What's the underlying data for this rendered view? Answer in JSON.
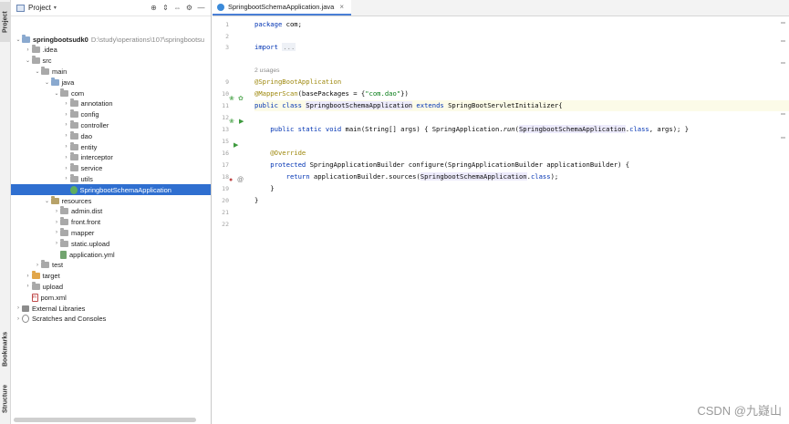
{
  "sidebar_strip": {
    "project_tab": "Project",
    "bookmarks_tab": "Bookmarks",
    "structure_tab": "Structure"
  },
  "project_panel": {
    "title": "Project",
    "tree": [
      {
        "label": "springbootsudk0",
        "hint": "D:\\study\\operations\\107\\springbootsu",
        "depth": 0,
        "arrow": "down",
        "icon": "folder-blue-icon",
        "bold": true
      },
      {
        "label": ".idea",
        "depth": 1,
        "arrow": "right",
        "icon": "folder-gray-icon"
      },
      {
        "label": "src",
        "depth": 1,
        "arrow": "down",
        "icon": "folder-gray-icon"
      },
      {
        "label": "main",
        "depth": 2,
        "arrow": "down",
        "icon": "folder-gray-icon"
      },
      {
        "label": "java",
        "depth": 3,
        "arrow": "down",
        "icon": "folder-blue-icon"
      },
      {
        "label": "com",
        "depth": 4,
        "arrow": "down",
        "icon": "package-icon"
      },
      {
        "label": "annotation",
        "depth": 5,
        "arrow": "right",
        "icon": "package-icon"
      },
      {
        "label": "config",
        "depth": 5,
        "arrow": "right",
        "icon": "package-icon"
      },
      {
        "label": "controller",
        "depth": 5,
        "arrow": "right",
        "icon": "package-icon"
      },
      {
        "label": "dao",
        "depth": 5,
        "arrow": "right",
        "icon": "package-icon"
      },
      {
        "label": "entity",
        "depth": 5,
        "arrow": "right",
        "icon": "package-icon"
      },
      {
        "label": "interceptor",
        "depth": 5,
        "arrow": "right",
        "icon": "package-icon"
      },
      {
        "label": "service",
        "depth": 5,
        "arrow": "right",
        "icon": "package-icon"
      },
      {
        "label": "utils",
        "depth": 5,
        "arrow": "right",
        "icon": "package-icon"
      },
      {
        "label": "SpringbootSchemaApplication",
        "depth": 5,
        "arrow": "",
        "icon": "spring-class-icon",
        "selected": true
      },
      {
        "label": "resources",
        "depth": 3,
        "arrow": "down",
        "icon": "resources-folder-icon"
      },
      {
        "label": "admin.dist",
        "depth": 4,
        "arrow": "right",
        "icon": "folder-gray-icon"
      },
      {
        "label": "front.front",
        "depth": 4,
        "arrow": "right",
        "icon": "folder-gray-icon"
      },
      {
        "label": "mapper",
        "depth": 4,
        "arrow": "right",
        "icon": "folder-gray-icon"
      },
      {
        "label": "static.upload",
        "depth": 4,
        "arrow": "right",
        "icon": "folder-gray-icon"
      },
      {
        "label": "application.yml",
        "depth": 4,
        "arrow": "",
        "icon": "yml-file-icon"
      },
      {
        "label": "test",
        "depth": 2,
        "arrow": "right",
        "icon": "folder-gray-icon"
      },
      {
        "label": "target",
        "depth": 1,
        "arrow": "right",
        "icon": "folder-orange-icon"
      },
      {
        "label": "upload",
        "depth": 1,
        "arrow": "right",
        "icon": "folder-gray-icon"
      },
      {
        "label": "pom.xml",
        "depth": 1,
        "arrow": "",
        "icon": "maven-file-icon"
      },
      {
        "label": "External Libraries",
        "depth": 0,
        "arrow": "right",
        "icon": "library-icon"
      },
      {
        "label": "Scratches and Consoles",
        "depth": 0,
        "arrow": "right",
        "icon": "scratch-icon"
      }
    ]
  },
  "editor": {
    "tab_label": "SpringbootSchemaApplication.java",
    "line_numbers": [
      "1",
      "2",
      "3",
      "",
      "9",
      "10",
      "11",
      "12",
      "13",
      "15",
      "16",
      "17",
      "18",
      "19",
      "20",
      "21",
      "22"
    ],
    "usages_text": "2 usages",
    "code": {
      "l1_kw": "package",
      "l1_rest": " com;",
      "l3_kw": "import",
      "l3_fold": "...",
      "l9": "@SpringBootApplication",
      "l10_ann": "@MapperScan",
      "l10_rest1": "(basePackages = {",
      "l10_str": "\"com.dao\"",
      "l10_rest2": "})",
      "l11_kw1": "public class ",
      "l11_cls": "SpringbootSchemaApplication",
      "l11_kw2": " extends ",
      "l11_rest": "SpringBootServletInitializer{",
      "l13_kw": "    public static void ",
      "l13_rest1": "main(String[] args) { SpringApplication.",
      "l13_run": "run",
      "l13_rest2": "(",
      "l13_cls": "SpringbootSchemaApplication",
      "l13_rest3": ".",
      "l13_kwc": "class",
      "l13_rest4": ", args); }",
      "l16": "    @Override",
      "l17_kw": "    protected ",
      "l17_rest": "SpringApplicationBuilder configure(SpringApplicationBuilder applicationBuilder) {",
      "l18_kw": "        return ",
      "l18_rest1": "applicationBuilder.sources(",
      "l18_cls": "SpringbootSchemaApplication",
      "l18_rest2": ".",
      "l18_kwc": "class",
      "l18_rest3": ");",
      "l19": "    }",
      "l20": "}"
    }
  },
  "watermark": "CSDN @九嶷山"
}
